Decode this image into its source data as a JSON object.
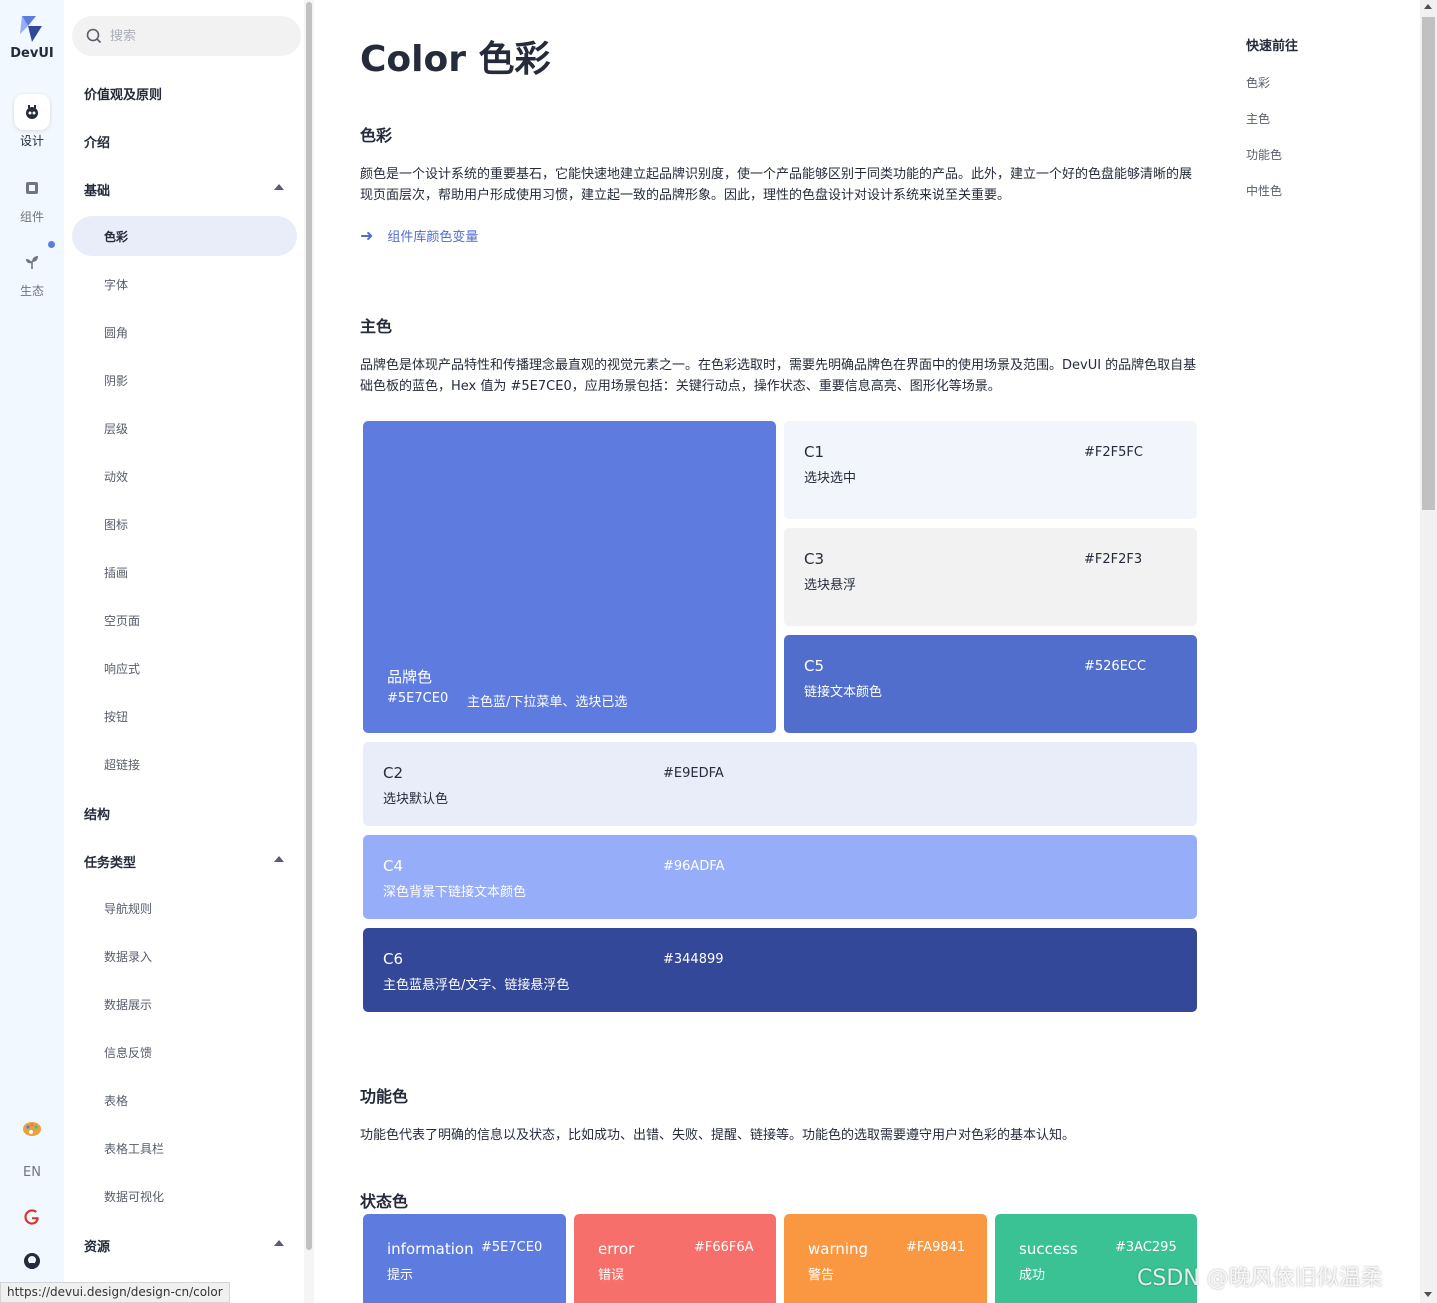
{
  "colors": {
    "brand": "#5E7CE0",
    "c1": "#F2F5FC",
    "c2": "#E9EDFA",
    "c3": "#F2F2F3",
    "c4": "#96ADFA",
    "c5": "#526ECC",
    "c6": "#344899",
    "info": "#5E7CE0",
    "error": "#F66F6A",
    "warning": "#FA9841",
    "success": "#3AC295"
  },
  "rail": {
    "brand": "DevUI",
    "items": [
      {
        "label": "设计",
        "icon": "design-bot-icon",
        "active": true
      },
      {
        "label": "组件",
        "icon": "component-icon"
      },
      {
        "label": "生态",
        "icon": "ecology-sprout-icon"
      }
    ],
    "bottom": {
      "theme_icon": "palette-icon",
      "lang": "EN",
      "g_icon": "google-icon",
      "github_icon": "github-icon"
    }
  },
  "nav": {
    "search_placeholder": "搜索",
    "groups": {
      "values": "价值观及原则",
      "intro": "介绍",
      "basic": "基础",
      "structure": "结构",
      "tasks": "任务类型",
      "resources": "资源"
    },
    "basic_items": [
      "色彩",
      "字体",
      "圆角",
      "阴影",
      "层级",
      "动效",
      "图标",
      "插画",
      "空页面",
      "响应式",
      "按钮",
      "超链接"
    ],
    "task_items": [
      "导航规则",
      "数据录入",
      "数据展示",
      "信息反馈",
      "表格",
      "表格工具栏",
      "数据可视化"
    ]
  },
  "main": {
    "title": "Color 色彩",
    "section_color": "色彩",
    "color_para": "颜色是一个设计系统的重要基石，它能快速地建立起品牌识别度，使一个产品能够区别于同类功能的产品。此外，建立一个好的色盘能够清晰的展现页面层次，帮助用户形成使用习惯，建立起一致的品牌形象。因此，理性的色盘设计对设计系统来说至关重要。",
    "link": "组件库颜色变量",
    "section_primary": "主色",
    "primary_para": "品牌色是体现产品特性和传播理念最直观的视觉元素之一。在色彩选取时，需要先明确品牌色在界面中的使用场景及范围。DevUI 的品牌色取自基础色板的蓝色，Hex 值为 #5E7CE0，应用场景包括：关键行动点，操作状态、重要信息高亮、图形化等场景。",
    "brand_swatch": {
      "name": "品牌色",
      "hex": "#5E7CE0",
      "desc": "主色蓝/下拉菜单、选块已选"
    },
    "swatches": {
      "c1": {
        "name": "C1",
        "hex": "#F2F5FC",
        "desc": "选块选中"
      },
      "c3": {
        "name": "C3",
        "hex": "#F2F2F3",
        "desc": "选块悬浮"
      },
      "c5": {
        "name": "C5",
        "hex": "#526ECC",
        "desc": "链接文本颜色"
      },
      "c2": {
        "name": "C2",
        "hex": "#E9EDFA",
        "desc": "选块默认色"
      },
      "c4": {
        "name": "C4",
        "hex": "#96ADFA",
        "desc": "深色背景下链接文本颜色"
      },
      "c6": {
        "name": "C6",
        "hex": "#344899",
        "desc": "主色蓝悬浮色/文字、链接悬浮色"
      }
    },
    "section_function": "功能色",
    "function_para": "功能色代表了明确的信息以及状态，比如成功、出错、失败、提醒、链接等。功能色的选取需要遵守用户对色彩的基本认知。",
    "section_status": "状态色",
    "status": {
      "info": {
        "name": "information",
        "hex": "#5E7CE0",
        "desc": "提示"
      },
      "error": {
        "name": "error",
        "hex": "#F66F6A",
        "desc": "错误"
      },
      "warning": {
        "name": "warning",
        "hex": "#FA9841",
        "desc": "警告"
      },
      "success": {
        "name": "success",
        "hex": "#3AC295",
        "desc": "成功"
      }
    }
  },
  "toc": {
    "title": "快速前往",
    "items": [
      "色彩",
      "主色",
      "功能色",
      "中性色"
    ]
  },
  "status_url": "https://devui.design/design-cn/color",
  "watermark": "CSDN @晚风依旧似温柔"
}
